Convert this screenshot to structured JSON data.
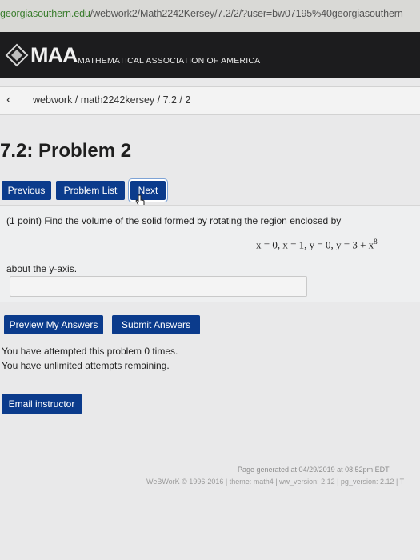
{
  "browser": {
    "url_host": "georgiasouthern.edu",
    "url_path": "/webwork2/Math2242Kersey/7.2/2/?user=bw07195%40georgiasouthern"
  },
  "banner": {
    "logo_icon": "maa-logo-icon",
    "name": "MAA",
    "subtitle": "MATHEMATICAL ASSOCIATION OF AMERICA",
    "background": "#1c1c1e"
  },
  "breadcrumb": {
    "back_icon": "chevron-left-icon",
    "text": "webwork / math2242kersey / 7.2 / 2"
  },
  "page_title": "7.2: Problem 2",
  "nav": {
    "previous": "Previous",
    "problem_list": "Problem List",
    "next": "Next"
  },
  "problem": {
    "statement": "(1 point) Find the volume of the solid formed by rotating the region enclosed by",
    "equation_main": "x = 0, x = 1, y = 0, y = 3 + x",
    "equation_exponent": "8",
    "axis_text": "about the y-axis.",
    "answer_value": ""
  },
  "actions": {
    "preview": "Preview My Answers",
    "submit": "Submit Answers"
  },
  "status": {
    "attempted": "You have attempted this problem 0 times.",
    "remaining": "You have unlimited attempts remaining."
  },
  "email_button": "Email instructor",
  "footer": {
    "generated": "Page generated at 04/29/2019 at 08:52pm EDT",
    "version": "WeBWorK © 1996-2016 | theme: math4 | ww_version: 2.12 | pg_version: 2.12 | T"
  },
  "colors": {
    "button_blue": "#0b3b8c",
    "url_green": "#3a7d2d"
  }
}
